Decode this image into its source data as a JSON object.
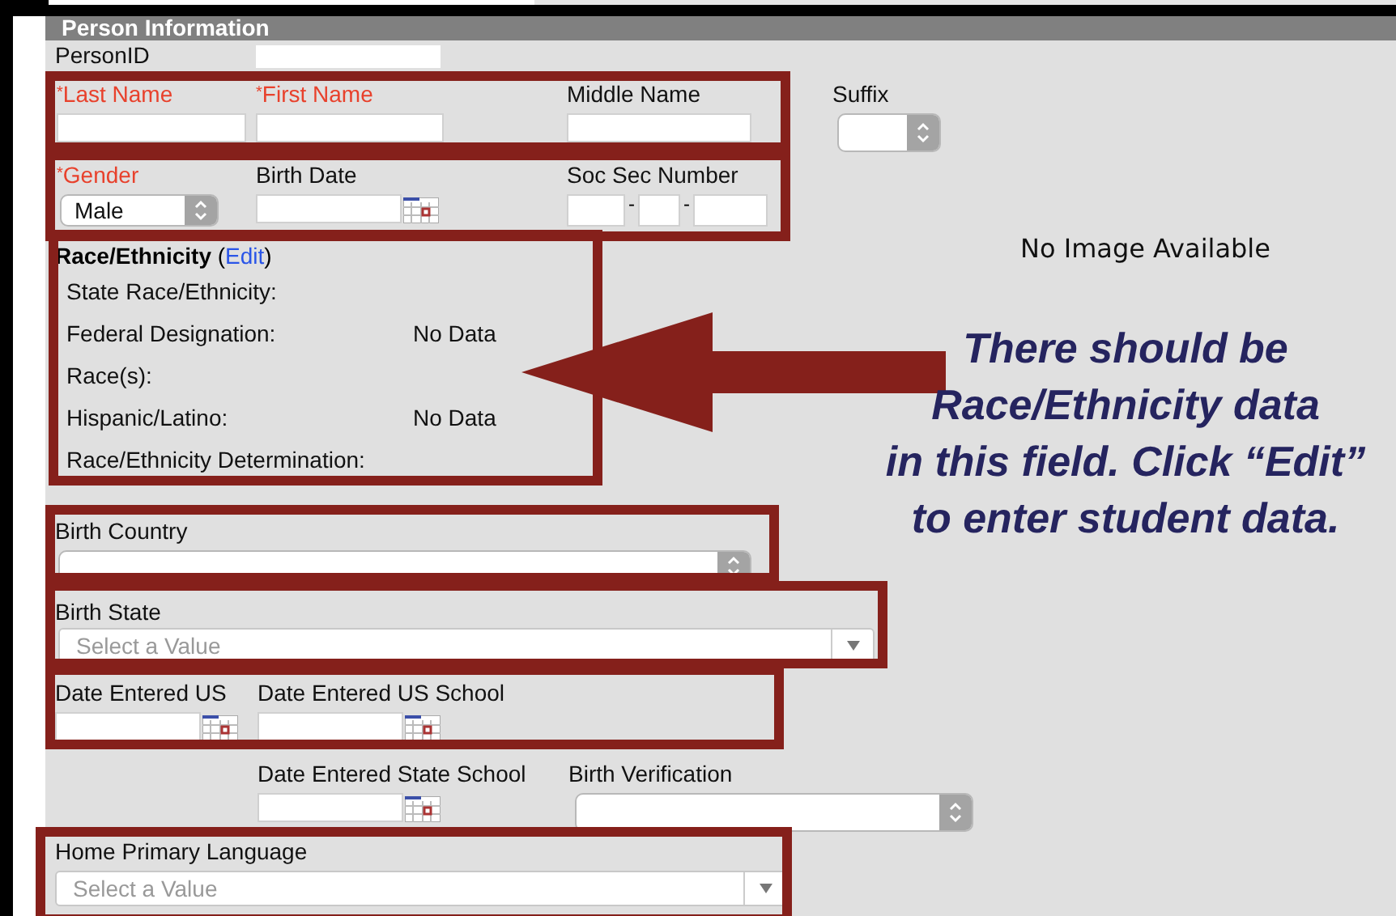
{
  "section_title": "Person Information",
  "required_mark": "*",
  "person_id": {
    "label": "PersonID"
  },
  "name_row": [
    {
      "label": "Last Name",
      "required": true,
      "kind": "text"
    },
    {
      "label": "First Name",
      "required": true,
      "kind": "text"
    },
    {
      "label": "Middle Name",
      "required": false,
      "kind": "text"
    },
    {
      "label": "Suffix",
      "required": false,
      "kind": "stepper"
    }
  ],
  "gender": {
    "label": "Gender",
    "required": true,
    "value": "Male"
  },
  "birth_date": {
    "label": "Birth Date"
  },
  "ssn": {
    "label": "Soc Sec Number",
    "separators": [
      "-",
      "-"
    ]
  },
  "photo_note": "No Image Available",
  "race": {
    "title": "Race/Ethnicity",
    "edit_open": "(",
    "edit_link": "Edit",
    "edit_close": ")",
    "rows": [
      {
        "label": "State Race/Ethnicity:"
      },
      {
        "label": "Federal Designation:",
        "value": "No Data"
      },
      {
        "label": "Race(s):"
      },
      {
        "label": "Hispanic/Latino:",
        "value": "No Data"
      },
      {
        "label": "Race/Ethnicity Determination:"
      }
    ]
  },
  "birth_country": {
    "label": "Birth Country",
    "kind": "stepper"
  },
  "birth_state": {
    "label": "Birth State",
    "kind": "dropdown",
    "placeholder": "Select a Value"
  },
  "date_entered_us": {
    "label": "Date Entered US"
  },
  "date_entered_us_school": {
    "label": "Date Entered US School"
  },
  "date_entered_state_school": {
    "label": "Date Entered State School"
  },
  "birth_verification": {
    "label": "Birth Verification",
    "kind": "stepper"
  },
  "home_primary_language": {
    "label": "Home Primary Language",
    "kind": "dropdown",
    "placeholder": "Select a Value"
  },
  "callout": [
    "There should be",
    "Race/Ethnicity data",
    "in this field. Click “Edit”",
    "to enter student data."
  ]
}
